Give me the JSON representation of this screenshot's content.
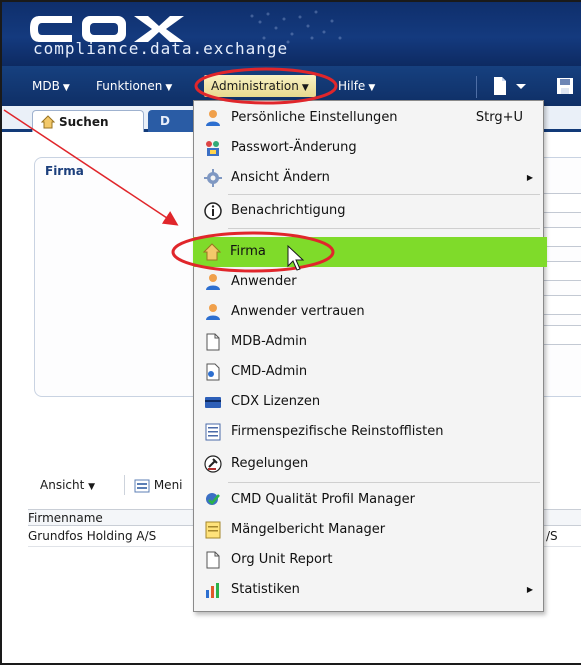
{
  "logo": {
    "text": "compliance.data.exchange",
    "wordmark": "CDX"
  },
  "menubar": {
    "items": [
      {
        "label": "MDB"
      },
      {
        "label": "Funktionen"
      },
      {
        "label": "Administration"
      },
      {
        "label": "Hilfe"
      }
    ]
  },
  "tabs": [
    {
      "label": "Suchen"
    },
    {
      "label": "D"
    }
  ],
  "panel": {
    "title": "Firma"
  },
  "list": {
    "view_label": "Ansicht",
    "menu_label": "Meni",
    "column_header": "Firmenname",
    "rows": [
      {
        "name": "Grundfos Holding A/S",
        "tail": "/S"
      }
    ]
  },
  "dropdown": {
    "items": [
      {
        "label": "Persönliche Einstellungen",
        "shortcut": "Strg+U",
        "icon": "person-settings-icon"
      },
      {
        "label": "Passwort-Änderung",
        "icon": "password-icon"
      },
      {
        "label": "Ansicht Ändern",
        "icon": "gear-icon",
        "submenu": true
      },
      {
        "label": "Benachrichtigung",
        "icon": "info-icon"
      },
      {
        "label": "Firma",
        "icon": "home-icon",
        "highlighted": true
      },
      {
        "label": "Anwender",
        "icon": "user-icon"
      },
      {
        "label": "Anwender vertrauen",
        "icon": "trusted-user-icon"
      },
      {
        "label": "MDB-Admin",
        "icon": "document-icon"
      },
      {
        "label": "CMD-Admin",
        "icon": "document-admin-icon"
      },
      {
        "label": "CDX Lizenzen",
        "icon": "license-card-icon"
      },
      {
        "label": "Firmenspezifische Reinstofflisten",
        "icon": "list-icon"
      },
      {
        "label": "Regelungen",
        "icon": "gavel-icon"
      },
      {
        "label": "CMD Qualität Profil Manager",
        "icon": "check-profile-icon"
      },
      {
        "label": "Mängelbericht Manager",
        "icon": "report-icon"
      },
      {
        "label": "Org Unit Report",
        "icon": "document-icon"
      },
      {
        "label": "Statistiken",
        "icon": "chart-icon",
        "submenu": true
      }
    ]
  },
  "colors": {
    "header_bg": "#0f2f6c",
    "highlight": "#7fdb2a",
    "annotation": "#e0262b"
  }
}
